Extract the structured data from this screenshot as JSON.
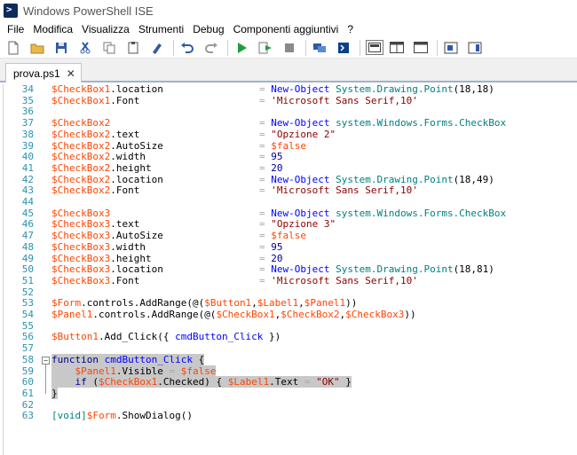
{
  "window": {
    "title": "Windows PowerShell ISE"
  },
  "menu": [
    "File",
    "Modifica",
    "Visualizza",
    "Strumenti",
    "Debug",
    "Componenti aggiuntivi",
    "?"
  ],
  "toolbar": {
    "icons": [
      "new-file-icon",
      "open-folder-icon",
      "save-icon",
      "cut-icon",
      "copy-icon",
      "paste-icon",
      "clear-console-icon",
      "undo-icon",
      "redo-icon",
      "run-script-icon",
      "run-selection-icon",
      "stop-icon",
      "remote-powershell-icon",
      "powershell-console-icon",
      "layout-script-top-icon",
      "layout-script-right-icon",
      "layout-script-maximized-icon",
      "show-commands-icon",
      "show-addon-icon"
    ]
  },
  "tab": {
    "label": "prova.ps1",
    "close": "✕"
  },
  "lines": [
    {
      "n": "34",
      "t": [
        [
          "var",
          "$CheckBox1"
        ],
        [
          "plain",
          ".location"
        ]
      ],
      "r": [
        [
          "op",
          "= "
        ],
        [
          "cmd",
          "New-Object"
        ],
        [
          "plain",
          " "
        ],
        [
          "typ",
          "System.Drawing.Point"
        ],
        [
          "plain",
          "(18,18)"
        ]
      ]
    },
    {
      "n": "35",
      "t": [
        [
          "var",
          "$CheckBox1"
        ],
        [
          "plain",
          ".Font"
        ]
      ],
      "r": [
        [
          "op",
          "= "
        ],
        [
          "str",
          "'Microsoft Sans Serif,10'"
        ]
      ]
    },
    {
      "n": "36",
      "t": [],
      "r": []
    },
    {
      "n": "37",
      "t": [
        [
          "var",
          "$CheckBox2"
        ]
      ],
      "r": [
        [
          "op",
          "= "
        ],
        [
          "cmd",
          "New-Object"
        ],
        [
          "plain",
          " "
        ],
        [
          "typ",
          "system.Windows.Forms.CheckBox"
        ]
      ]
    },
    {
      "n": "38",
      "t": [
        [
          "var",
          "$CheckBox2"
        ],
        [
          "plain",
          ".text"
        ]
      ],
      "r": [
        [
          "op",
          "= "
        ],
        [
          "str",
          "\"Opzione 2\""
        ]
      ]
    },
    {
      "n": "39",
      "t": [
        [
          "var",
          "$CheckBox2"
        ],
        [
          "plain",
          ".AutoSize"
        ]
      ],
      "r": [
        [
          "op",
          "= "
        ],
        [
          "var",
          "$false"
        ]
      ]
    },
    {
      "n": "40",
      "t": [
        [
          "var",
          "$CheckBox2"
        ],
        [
          "plain",
          ".width"
        ]
      ],
      "r": [
        [
          "op",
          "= "
        ],
        [
          "kw",
          "95"
        ]
      ]
    },
    {
      "n": "41",
      "t": [
        [
          "var",
          "$CheckBox2"
        ],
        [
          "plain",
          ".height"
        ]
      ],
      "r": [
        [
          "op",
          "= "
        ],
        [
          "kw",
          "20"
        ]
      ]
    },
    {
      "n": "42",
      "t": [
        [
          "var",
          "$CheckBox2"
        ],
        [
          "plain",
          ".location"
        ]
      ],
      "r": [
        [
          "op",
          "= "
        ],
        [
          "cmd",
          "New-Object"
        ],
        [
          "plain",
          " "
        ],
        [
          "typ",
          "System.Drawing.Point"
        ],
        [
          "plain",
          "(18,49)"
        ]
      ]
    },
    {
      "n": "43",
      "t": [
        [
          "var",
          "$CheckBox2"
        ],
        [
          "plain",
          ".Font"
        ]
      ],
      "r": [
        [
          "op",
          "= "
        ],
        [
          "str",
          "'Microsoft Sans Serif,10'"
        ]
      ]
    },
    {
      "n": "44",
      "t": [],
      "r": []
    },
    {
      "n": "45",
      "t": [
        [
          "var",
          "$CheckBox3"
        ]
      ],
      "r": [
        [
          "op",
          "= "
        ],
        [
          "cmd",
          "New-Object"
        ],
        [
          "plain",
          " "
        ],
        [
          "typ",
          "system.Windows.Forms.CheckBox"
        ]
      ]
    },
    {
      "n": "46",
      "t": [
        [
          "var",
          "$CheckBox3"
        ],
        [
          "plain",
          ".text"
        ]
      ],
      "r": [
        [
          "op",
          "= "
        ],
        [
          "str",
          "\"Opzione 3\""
        ]
      ]
    },
    {
      "n": "47",
      "t": [
        [
          "var",
          "$CheckBox3"
        ],
        [
          "plain",
          ".AutoSize"
        ]
      ],
      "r": [
        [
          "op",
          "= "
        ],
        [
          "var",
          "$false"
        ]
      ]
    },
    {
      "n": "48",
      "t": [
        [
          "var",
          "$CheckBox3"
        ],
        [
          "plain",
          ".width"
        ]
      ],
      "r": [
        [
          "op",
          "= "
        ],
        [
          "kw",
          "95"
        ]
      ]
    },
    {
      "n": "49",
      "t": [
        [
          "var",
          "$CheckBox3"
        ],
        [
          "plain",
          ".height"
        ]
      ],
      "r": [
        [
          "op",
          "= "
        ],
        [
          "kw",
          "20"
        ]
      ]
    },
    {
      "n": "50",
      "t": [
        [
          "var",
          "$CheckBox3"
        ],
        [
          "plain",
          ".location"
        ]
      ],
      "r": [
        [
          "op",
          "= "
        ],
        [
          "cmd",
          "New-Object"
        ],
        [
          "plain",
          " "
        ],
        [
          "typ",
          "System.Drawing.Point"
        ],
        [
          "plain",
          "(18,81)"
        ]
      ]
    },
    {
      "n": "51",
      "t": [
        [
          "var",
          "$CheckBox3"
        ],
        [
          "plain",
          ".Font"
        ]
      ],
      "r": [
        [
          "op",
          "= "
        ],
        [
          "str",
          "'Microsoft Sans Serif,10'"
        ]
      ]
    },
    {
      "n": "52",
      "t": [],
      "r": []
    },
    {
      "n": "53",
      "t": [
        [
          "var",
          "$Form"
        ],
        [
          "plain",
          ".controls.AddRange(@("
        ],
        [
          "var",
          "$Button1"
        ],
        [
          "plain",
          ","
        ],
        [
          "var",
          "$Label1"
        ],
        [
          "plain",
          ","
        ],
        [
          "var",
          "$Panel1"
        ],
        [
          "plain",
          "))"
        ]
      ],
      "r": []
    },
    {
      "n": "54",
      "t": [
        [
          "var",
          "$Panel1"
        ],
        [
          "plain",
          ".controls.AddRange(@("
        ],
        [
          "var",
          "$CheckBox1"
        ],
        [
          "plain",
          ","
        ],
        [
          "var",
          "$CheckBox2"
        ],
        [
          "plain",
          ","
        ],
        [
          "var",
          "$CheckBox3"
        ],
        [
          "plain",
          "))"
        ]
      ],
      "r": []
    },
    {
      "n": "55",
      "t": [],
      "r": []
    },
    {
      "n": "56",
      "t": [
        [
          "var",
          "$Button1"
        ],
        [
          "plain",
          ".Add_Click({ "
        ],
        [
          "cmd",
          "cmdButton_Click"
        ],
        [
          "plain",
          " })"
        ]
      ],
      "r": []
    },
    {
      "n": "57",
      "t": [],
      "r": []
    },
    {
      "n": "58",
      "t": [
        [
          "kw",
          "function"
        ],
        [
          "plain",
          " "
        ],
        [
          "cmd",
          "cmdButton_Click"
        ],
        [
          "plain",
          " {"
        ]
      ],
      "r": [],
      "fold": "−",
      "sel": true
    },
    {
      "n": "59",
      "t": [
        [
          "plain",
          "    "
        ],
        [
          "var",
          "$Panel1"
        ],
        [
          "plain",
          "."
        ],
        [
          "plain",
          "Visible"
        ],
        [
          "op",
          " = "
        ],
        [
          "var",
          "$false"
        ]
      ],
      "r": [],
      "sel": true
    },
    {
      "n": "60",
      "t": [
        [
          "plain",
          "    "
        ],
        [
          "kw",
          "if"
        ],
        [
          "plain",
          " ("
        ],
        [
          "var",
          "$CheckBox1"
        ],
        [
          "plain",
          "."
        ],
        [
          "plain",
          "Checked) { "
        ],
        [
          "var",
          "$Label1"
        ],
        [
          "plain",
          "."
        ],
        [
          "plain",
          "Text"
        ],
        [
          "op",
          " = "
        ],
        [
          "str",
          "\"OK\""
        ],
        [
          "plain",
          " }"
        ]
      ],
      "r": [],
      "sel": true
    },
    {
      "n": "61",
      "t": [
        [
          "plain",
          "}"
        ]
      ],
      "r": [],
      "sel": true
    },
    {
      "n": "62",
      "t": [],
      "r": []
    },
    {
      "n": "63",
      "t": [
        [
          "typ",
          "[void]"
        ],
        [
          "var",
          "$Form"
        ],
        [
          "plain",
          ".ShowDialog()"
        ]
      ],
      "r": []
    }
  ]
}
